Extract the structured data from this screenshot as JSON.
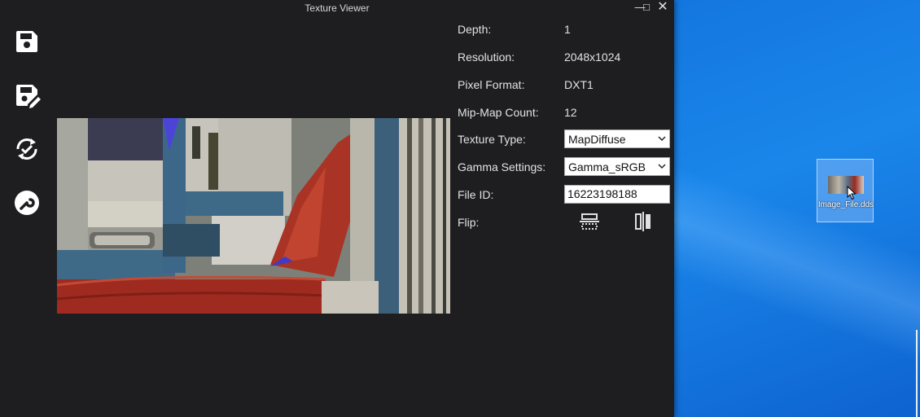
{
  "window": {
    "title": "Texture Viewer",
    "controls": {
      "minimize": "—",
      "maximize": "□",
      "close": "✕"
    }
  },
  "toolbar": {
    "items": [
      {
        "name": "save-icon"
      },
      {
        "name": "save-as-icon"
      },
      {
        "name": "convert-icon"
      },
      {
        "name": "wrench-icon"
      }
    ]
  },
  "properties": {
    "depth": {
      "label": "Depth:",
      "value": "1"
    },
    "resolution": {
      "label": "Resolution:",
      "value": "2048x1024"
    },
    "pixel_format": {
      "label": "Pixel Format:",
      "value": "DXT1"
    },
    "mipmap_count": {
      "label": "Mip-Map Count:",
      "value": "12"
    },
    "texture_type": {
      "label": "Texture Type:",
      "value": "MapDiffuse"
    },
    "gamma": {
      "label": "Gamma Settings:",
      "value": "Gamma_sRGB"
    },
    "file_id": {
      "label": "File ID:",
      "value": "16223198188"
    },
    "flip": {
      "label": "Flip:",
      "vertical_icon": "flip-vertical-icon",
      "horizontal_icon": "flip-horizontal-icon"
    }
  },
  "desktop": {
    "icon_label": "Image_File.dds"
  },
  "colors": {
    "window_bg": "#1e1e21",
    "desktop_bg": "#1478e0"
  }
}
